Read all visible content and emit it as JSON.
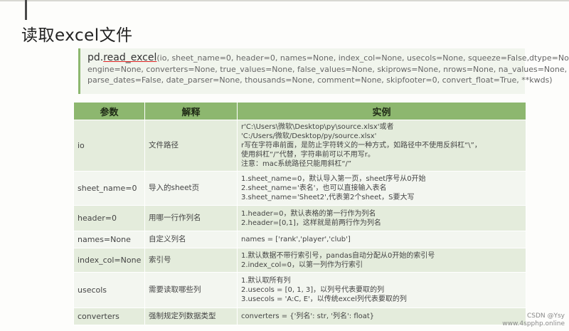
{
  "title": "读取excel文件",
  "signature": {
    "prefix": "pd.",
    "fn": "read_excel",
    "line1_rest": "(io, sheet_name=0, header=0, names=None, index_col=None, usecols=None, squeeze=False,dtype=None,",
    "line2": "engine=None, converters=None, true_values=None, false_values=None, skiprows=None, nrows=None, na_values=None,",
    "line3": "parse_dates=False, date_parser=None, thousands=None, comment=None, skipfooter=0, convert_float=True, **kwds)"
  },
  "table": {
    "headers": [
      "参数",
      "解释",
      "实例"
    ],
    "rows": [
      {
        "param": "io",
        "desc": "文件路径",
        "example": [
          "r'C:\\Users\\微软\\Desktop\\py\\source.xlsx'或者",
          "'C:/Users/微软/Desktop/py/source.xlsx'",
          "r写在字符串前面，是防止字符转义的一种方式，如路径中不使用反斜杠“\\”，",
          "使用斜杠“/”代替，字符串前可以不用写r。",
          "注意：mac系统路径只能用斜杠“/”"
        ]
      },
      {
        "param": "sheet_name=0",
        "desc": "导入的sheet页",
        "example": [
          "1.sheet_name=0，默认导入第一页，sheet序号从0开始",
          "2.sheet_name='表名'，也可以直接输入表名",
          "3.sheet_name='Sheet2',代表第2个sheet，S要大写"
        ]
      },
      {
        "param": "header=0",
        "desc": "用哪一行作列名",
        "example": [
          "1.header=0，默认表格的第一行作为列名",
          "2.header=[0,1]，这样就是前两行作为列名"
        ]
      },
      {
        "param": "names=None",
        "desc": "自定义列名",
        "example": [
          "names = ['rank','player','club']"
        ]
      },
      {
        "param": "index_col=None",
        "desc": "索引号",
        "example": [
          "1.默认数据不带行索引号，pandas自动分配从0开始的索引号",
          "2.index_col=0，以第一列作为行索引"
        ]
      },
      {
        "param": "usecols",
        "desc": "需要读取哪些列",
        "example": [
          "1.默认取所有列",
          "2.usecols = [0, 1, 3]，以列号代表要取的列",
          "3.usecols = 'A:C, E'，以传统excel列代表要取的列"
        ]
      },
      {
        "param": "converters",
        "desc": "强制规定列数据类型",
        "example": [
          "converters = {'列名': str, '列名': float}"
        ]
      }
    ]
  },
  "watermark": {
    "line1": "CSDN @Ysy",
    "line2": "www.4spphp.online"
  }
}
